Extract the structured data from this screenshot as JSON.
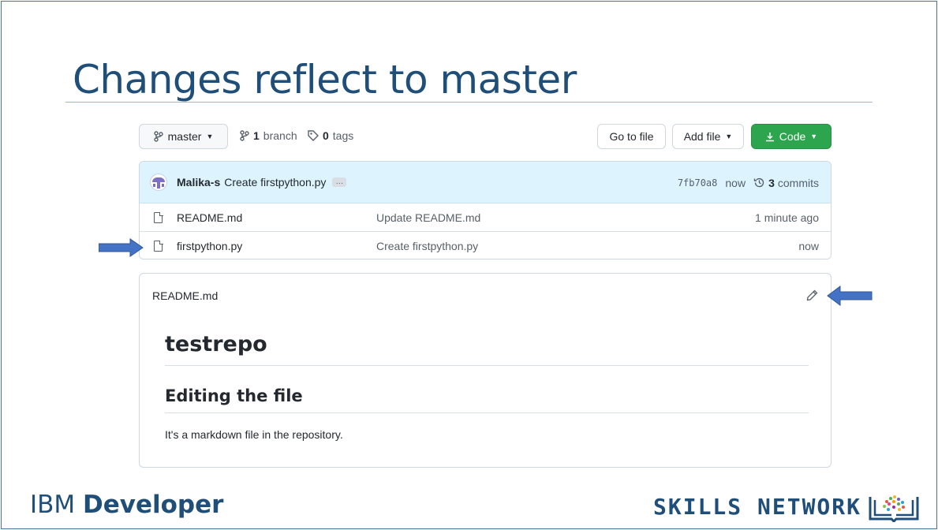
{
  "slide": {
    "title": "Changes reflect to master",
    "footer_left_light": "IBM",
    "footer_left_bold": "Developer",
    "footer_right": "SKILLS NETWORK"
  },
  "toolbar": {
    "branch_button": "master",
    "branch_count": "1",
    "branch_word": "branch",
    "tag_count": "0",
    "tag_word": "tags",
    "goto_file": "Go to file",
    "add_file": "Add file",
    "code": "Code"
  },
  "commit": {
    "author": "Malika-s",
    "message": "Create firstpython.py",
    "ellipsis": "…",
    "sha": "7fb70a8",
    "time": "now",
    "commit_count": "3",
    "commit_word": "commits"
  },
  "files": [
    {
      "name": "README.md",
      "last_commit": "Update README.md",
      "age": "1 minute ago"
    },
    {
      "name": "firstpython.py",
      "last_commit": "Create firstpython.py",
      "age": "now"
    }
  ],
  "readme": {
    "filename": "README.md",
    "h1": "testrepo",
    "h2": "Editing the file",
    "paragraph": "It's a markdown file in the repository."
  },
  "colors": {
    "title": "#1f4e79",
    "arrow": "#4472c4",
    "code_button": "#2da44e",
    "commit_bar": "#ddf4ff"
  },
  "icons": {
    "branch": "git-branch-icon",
    "tag": "tag-icon",
    "history": "history-icon",
    "file": "file-icon",
    "pencil": "pencil-icon",
    "download": "download-icon"
  }
}
